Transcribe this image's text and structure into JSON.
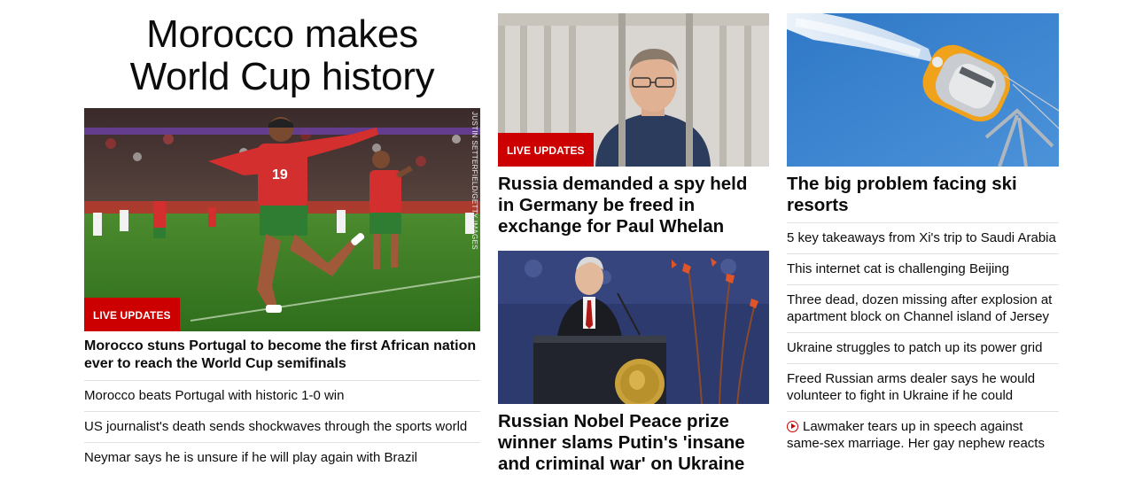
{
  "hero": {
    "title_line1": "Morocco makes",
    "title_line2": "World Cup history",
    "badge": "LIVE UPDATES",
    "credit": "JUSTIN SETTERFIELD/GETTY IMAGES",
    "headline": "Morocco stuns Portugal to become the first African nation ever to reach the World Cup semifinals",
    "links": [
      "Morocco beats Portugal with historic 1-0 win",
      "US journalist's death sends shockwaves through the sports world",
      "Neymar says he is unsure if he will play again with Brazil"
    ]
  },
  "middle": {
    "story1": {
      "badge": "LIVE UPDATES",
      "headline": "Russia demanded a spy held in Germany be freed in exchange for Paul Whelan"
    },
    "story2": {
      "headline": "Russian Nobel Peace prize winner slams Putin's 'insane and criminal war' on Ukraine"
    }
  },
  "right": {
    "headline": "The big problem facing ski resorts",
    "links": [
      "5 key takeaways from Xi's trip to Saudi Arabia",
      "This internet cat is challenging Beijing",
      "Three dead, dozen missing after explosion at apartment block on Channel island of Jersey",
      "Ukraine struggles to patch up its power grid",
      "Freed Russian arms dealer says he would volunteer to fight in Ukraine if he could"
    ],
    "video_link": "Lawmaker tears up in speech against same-sex marriage. Her gay nephew reacts",
    "video_icon": "play-icon"
  },
  "colors": {
    "accent_red": "#cc0000",
    "text": "#0c0c0c",
    "divider": "#e2e2e2"
  }
}
